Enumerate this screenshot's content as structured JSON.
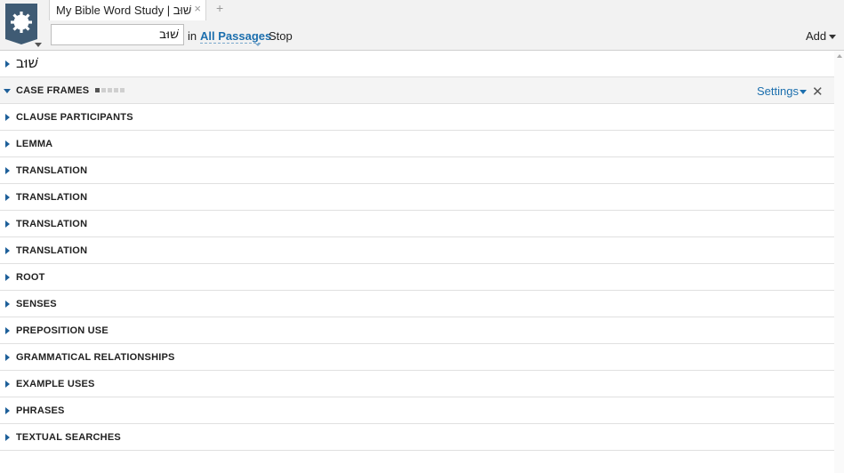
{
  "tab": {
    "title": "My Bible Word Study | שׁוּב",
    "close_glyph": "×",
    "add_glyph": "+"
  },
  "toolbar": {
    "search_value": "שׁוּב",
    "in_label": "in",
    "passages_label": "All Passages",
    "stop_label": "Stop",
    "add_label": "Add"
  },
  "word": {
    "text": "שׁוּב"
  },
  "open_section": {
    "label": "CASE FRAMES",
    "settings_label": "Settings",
    "close_glyph": "✕",
    "loading_progress": 0.2
  },
  "sections": [
    {
      "label": "CLAUSE PARTICIPANTS"
    },
    {
      "label": "LEMMA"
    },
    {
      "label": "TRANSLATION"
    },
    {
      "label": "TRANSLATION"
    },
    {
      "label": "TRANSLATION"
    },
    {
      "label": "TRANSLATION"
    },
    {
      "label": "ROOT"
    },
    {
      "label": "SENSES"
    },
    {
      "label": "PREPOSITION USE"
    },
    {
      "label": "GRAMMATICAL RELATIONSHIPS"
    },
    {
      "label": "EXAMPLE USES"
    },
    {
      "label": "PHRASES"
    },
    {
      "label": "TEXTUAL SEARCHES"
    }
  ],
  "colors": {
    "accent": "#1c6fae",
    "triangle": "#1d5f99",
    "logo": "#3f5b74"
  },
  "icons": {
    "logo": "gear-logo-icon",
    "expand": "triangle-right-icon",
    "collapse": "triangle-down-icon",
    "close": "close-icon"
  }
}
